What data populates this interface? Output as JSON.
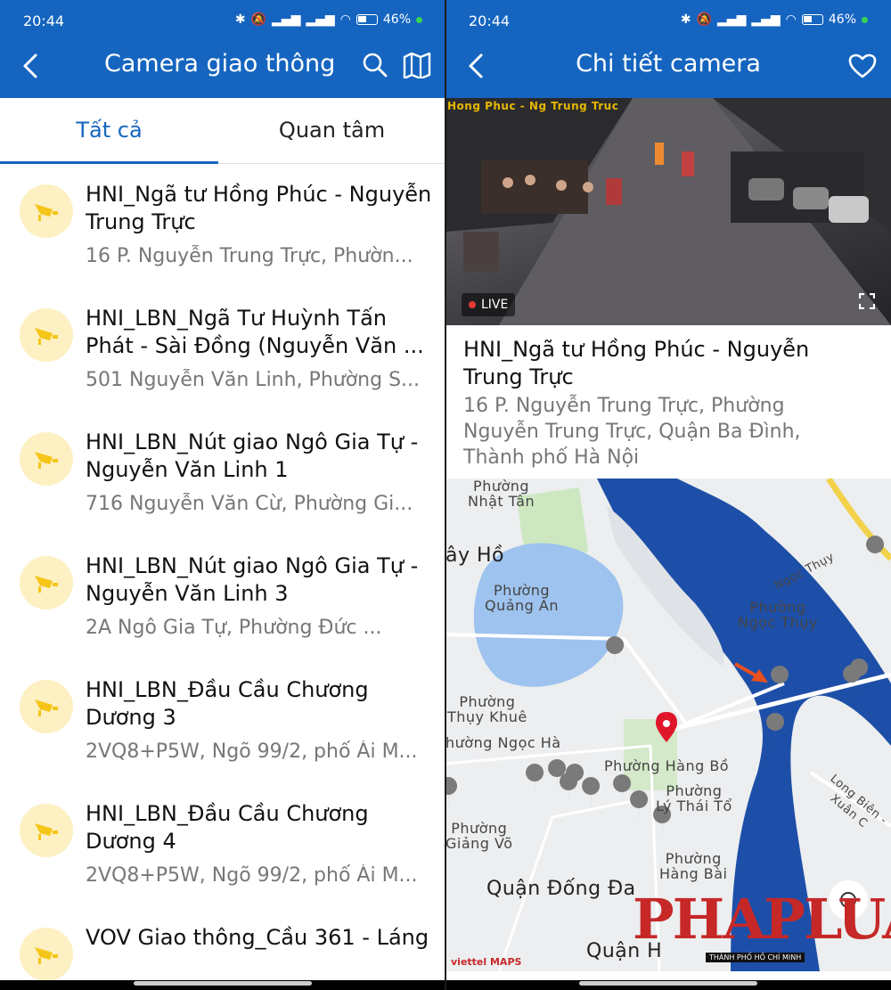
{
  "status": {
    "time": "20:44",
    "battery": "46%"
  },
  "left": {
    "title": "Camera giao thông",
    "tabs": [
      {
        "label": "Tất cả"
      },
      {
        "label": "Quan tâm"
      }
    ],
    "items": [
      {
        "name": "HNI_Ngã tư Hồng Phúc - Nguyễn Trung Trực",
        "address": "16 P. Nguyễn Trung Trực, Phườn..."
      },
      {
        "name": "HNI_LBN_Ngã Tư Huỳnh Tấn Phát - Sài Đồng (Nguyễn Văn ...",
        "address": "501 Nguyễn Văn Linh, Phường S..."
      },
      {
        "name": "HNI_LBN_Nút giao Ngô Gia Tự - Nguyễn Văn Linh 1",
        "address": "716 Nguyễn Văn Cừ, Phường Gi..."
      },
      {
        "name": "HNI_LBN_Nút giao Ngô Gia Tự - Nguyễn Văn Linh 3",
        "address": "2A Ngô Gia Tự, Phường Đức ..."
      },
      {
        "name": "HNI_LBN_Đầu Cầu Chương Dương 3",
        "address": "2VQ8+P5W, Ngõ 99/2, phố Ái M..."
      },
      {
        "name": "HNI_LBN_Đầu Cầu Chương Dương 4",
        "address": "2VQ8+P5W, Ngõ 99/2, phố Ái M..."
      },
      {
        "name": "VOV Giao thông_Cầu 361 - Láng",
        "address": ""
      }
    ]
  },
  "right": {
    "title": "Chi tiết camera",
    "video": {
      "overlay_label": "Hong Phuc - Ng Trung Truc",
      "live": "LIVE"
    },
    "camera_name": "HNI_Ngã tư Hồng Phúc - Nguyễn Trung Trực",
    "camera_address": "16 P. Nguyễn Trung Trực, Phường Nguyễn Trung Trực, Quận Ba Đình, Thành phố Hà Nội",
    "map": {
      "labels": {
        "nhat_tan": "Phường\nNhật Tân",
        "tay_ho": "ây Hồ",
        "quang_an": "Phường\nQuảng An",
        "ngoc_thuy_road": "Ngọc Thụy",
        "ngoc_thuy": "Phường\nNgọc Thụy",
        "thuy_khue": "Phường\nThụy Khuê",
        "ngoc_ha": "hường Ngọc Hà",
        "hang_bo": "Phường Hàng Bồ",
        "ly_thai_to": "Phường\nLý Thái Tổ",
        "long_bien": "Long Biên - Xuân C",
        "giang_vo": "Phường\nGiảng Võ",
        "hang_bai": "Phường\nHàng Bài",
        "dong_da": "Quận Đống Đa",
        "quan_h": "Quận H"
      },
      "attribution": "viettel MAPS"
    },
    "watermark": "PHAPLUAT",
    "watermark_sub": "THÀNH PHỐ HỒ CHÍ MINH"
  },
  "colors": {
    "primary": "#1565c0",
    "marker": "#e0162b",
    "pin": "#7a7a7a",
    "river": "#1e4fa8",
    "arrow": "#e8501e"
  }
}
